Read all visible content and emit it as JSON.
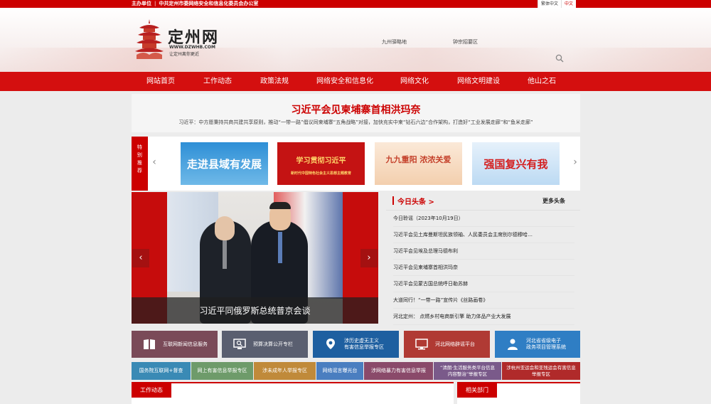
{
  "topbar": {
    "sponsor_label": "主办单位",
    "sponsor_name": "中共定州市委网络安全和信息化委员会办公室",
    "lang_traditional": "繁体中文",
    "lang_simplified": "中文"
  },
  "logo": {
    "title": "定州网",
    "url": "WWW.DZWHB.COM",
    "slogan": "让定州离你更近"
  },
  "header_links": [
    "九州驿略地",
    "钟宗招要区"
  ],
  "nav": [
    "网站首页",
    "工作动态",
    "政策法规",
    "网络安全和信息化",
    "网络文化",
    "网络文明建设",
    "他山之石"
  ],
  "headline": {
    "title": "习近平会见柬埔寨首相洪玛奈",
    "summary": "习近平：中方愿秉持共商共建共享原则，推动“一带一路”倡议同柬埔寨“五角战略”对接，加快充实中柬“钻石六边”合作架构，打造好“工业发展走廊”和“鱼米走廊”"
  },
  "special": {
    "tag": "特别推荐",
    "banners": [
      "走进县域有发展",
      "学习贯彻习近平",
      "新时代中国特色社会主义思想主题教育",
      "九九重阳 浓浓关爱",
      "强国复兴有我"
    ]
  },
  "carousel": {
    "caption": "习近平同俄罗斯总统普京会谈"
  },
  "today": {
    "title": "今日头条 >",
    "more": "更多头条",
    "items": [
      "今日聆谣（2023年10月19日）",
      "习近平会见土库曼斯坦民族领袖、人民委员会主席别尔德穆哈…",
      "习近平会见埃及总理马德布利",
      "习近平会见柬埔寨首相洪玛奈",
      "习近平会见蒙古国总统呼日勒苏赫",
      "大道同行！“一带一路”宣传片《丝路画卷》",
      "河北定州： 点燃乡村电商新引擎 助力体品产业大发展"
    ]
  },
  "tiles": [
    {
      "label": "互联网新闻信息服务",
      "color": "#7a4a58",
      "icon": "book-icon"
    },
    {
      "label": "预算决算公开专栏",
      "color": "#5a5f70",
      "icon": "monitor-search-icon"
    },
    {
      "label": "涉历史虚无主义\n有害信息举报专区",
      "color": "#1e5fa0",
      "icon": "location-pin-icon"
    },
    {
      "label": "河北网络辟谣平台",
      "color": "#b03a34",
      "icon": "screen-icon"
    },
    {
      "label": "河北省省级电子\n政务项目管理系统",
      "color": "#2f7ec4",
      "icon": "user-icon"
    }
  ],
  "link_buttons": [
    {
      "label": "国务院互联网+督查",
      "color": "#3a8ab5"
    },
    {
      "label": "网上有害信息举报专区",
      "color": "#6e9b6a"
    },
    {
      "label": "涉未成年人举报专区",
      "color": "#c08a3a"
    },
    {
      "label": "网络谣言曝光台",
      "color": "#4a7ec0"
    },
    {
      "label": "涉网络暴力有害信息举报",
      "color": "#8a4a6a"
    },
    {
      "label": "“清朗·生活服务类平台信息\n内容整治”举报专区",
      "color": "#7a5a8a"
    },
    {
      "label": "涉杭州亚运会和亚残运会有害信息\n举报专区",
      "color": "#b02a2a"
    }
  ],
  "panels": {
    "work_news": "工作动态",
    "related_depts": "相关部门"
  },
  "colors": {
    "brand_red": "#cc0000",
    "nav_red": "#d40f0f"
  }
}
